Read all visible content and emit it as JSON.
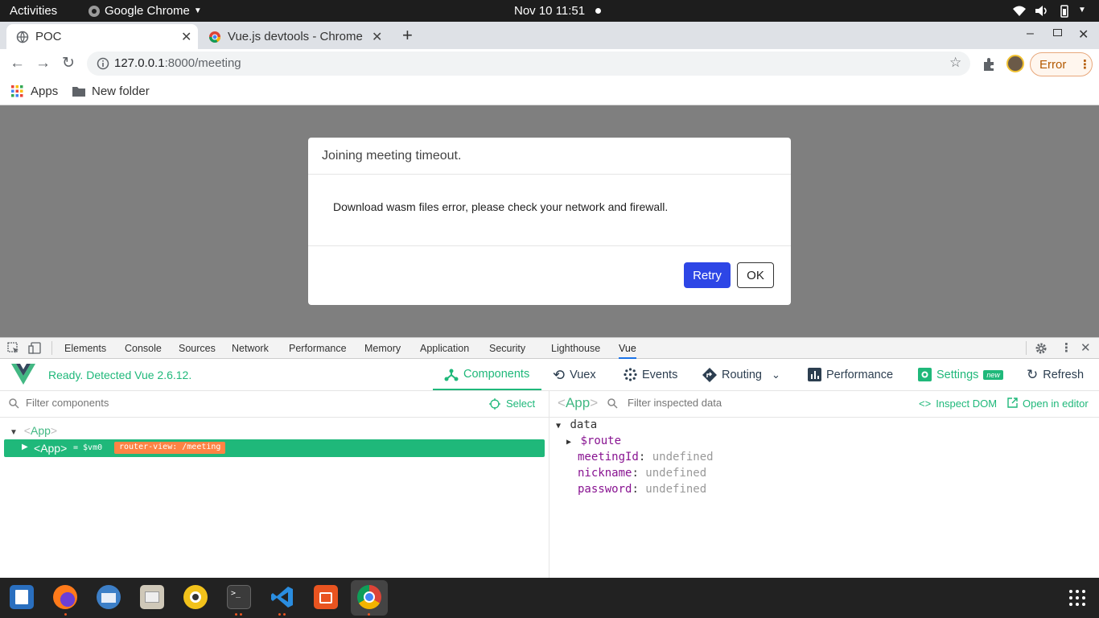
{
  "topbar": {
    "activities": "Activities",
    "app_name": "Google Chrome",
    "clock": "Nov 10  11:51"
  },
  "tabs": [
    {
      "title": "POC",
      "active": true
    },
    {
      "title": "Vue.js devtools - Chrome W",
      "active": false
    }
  ],
  "toolbar": {
    "url_host": "127.0.0.1",
    "url_rest": ":8000/meeting",
    "error_label": "Error"
  },
  "bookmarks": {
    "apps": "Apps",
    "folder": "New folder"
  },
  "modal": {
    "title": "Joining meeting timeout.",
    "message": "Download wasm files error, please check your network and firewall.",
    "retry_label": "Retry",
    "ok_label": "OK",
    "accent": "#2d46e6"
  },
  "devtools": {
    "tabs": [
      "Elements",
      "Console",
      "Sources",
      "Network",
      "Performance",
      "Memory",
      "Application",
      "Security",
      "Lighthouse",
      "Vue"
    ],
    "active_tab": "Vue"
  },
  "vue": {
    "status": "Ready. Detected Vue 2.6.12.",
    "nav": {
      "components": "Components",
      "vuex": "Vuex",
      "events": "Events",
      "routing": "Routing",
      "performance": "Performance",
      "settings": "Settings",
      "settings_badge": "new",
      "refresh": "Refresh"
    },
    "accent": "#1fb87a",
    "left": {
      "filter_placeholder": "Filter components",
      "select_label": "Select",
      "tree_root": "App",
      "tree_child": "App",
      "tree_child_ref": "= $vm0",
      "router_badge": "router-view: /meeting"
    },
    "right": {
      "component_name": "App",
      "filter_placeholder": "Filter inspected data",
      "inspect_dom": "Inspect DOM",
      "open_editor": "Open in editor",
      "section": "data",
      "route_key": "$route",
      "props": [
        {
          "key": "meetingId",
          "value": "undefined"
        },
        {
          "key": "nickname",
          "value": "undefined"
        },
        {
          "key": "password",
          "value": "undefined"
        }
      ]
    }
  }
}
